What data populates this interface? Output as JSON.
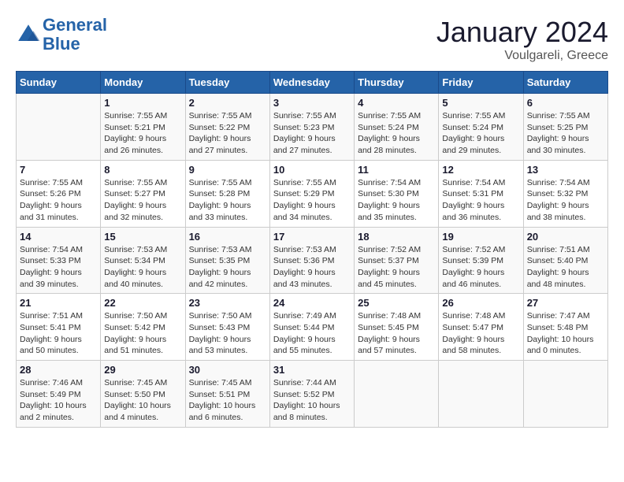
{
  "header": {
    "logo_line1": "General",
    "logo_line2": "Blue",
    "month_year": "January 2024",
    "location": "Voulgareli, Greece"
  },
  "weekdays": [
    "Sunday",
    "Monday",
    "Tuesday",
    "Wednesday",
    "Thursday",
    "Friday",
    "Saturday"
  ],
  "weeks": [
    [
      {
        "empty": true
      },
      {
        "day": 1,
        "sunrise": "7:55 AM",
        "sunset": "5:21 PM",
        "daylight": "9 hours and 26 minutes."
      },
      {
        "day": 2,
        "sunrise": "7:55 AM",
        "sunset": "5:22 PM",
        "daylight": "9 hours and 27 minutes."
      },
      {
        "day": 3,
        "sunrise": "7:55 AM",
        "sunset": "5:23 PM",
        "daylight": "9 hours and 27 minutes."
      },
      {
        "day": 4,
        "sunrise": "7:55 AM",
        "sunset": "5:24 PM",
        "daylight": "9 hours and 28 minutes."
      },
      {
        "day": 5,
        "sunrise": "7:55 AM",
        "sunset": "5:24 PM",
        "daylight": "9 hours and 29 minutes."
      },
      {
        "day": 6,
        "sunrise": "7:55 AM",
        "sunset": "5:25 PM",
        "daylight": "9 hours and 30 minutes."
      }
    ],
    [
      {
        "day": 7,
        "sunrise": "7:55 AM",
        "sunset": "5:26 PM",
        "daylight": "9 hours and 31 minutes."
      },
      {
        "day": 8,
        "sunrise": "7:55 AM",
        "sunset": "5:27 PM",
        "daylight": "9 hours and 32 minutes."
      },
      {
        "day": 9,
        "sunrise": "7:55 AM",
        "sunset": "5:28 PM",
        "daylight": "9 hours and 33 minutes."
      },
      {
        "day": 10,
        "sunrise": "7:55 AM",
        "sunset": "5:29 PM",
        "daylight": "9 hours and 34 minutes."
      },
      {
        "day": 11,
        "sunrise": "7:54 AM",
        "sunset": "5:30 PM",
        "daylight": "9 hours and 35 minutes."
      },
      {
        "day": 12,
        "sunrise": "7:54 AM",
        "sunset": "5:31 PM",
        "daylight": "9 hours and 36 minutes."
      },
      {
        "day": 13,
        "sunrise": "7:54 AM",
        "sunset": "5:32 PM",
        "daylight": "9 hours and 38 minutes."
      }
    ],
    [
      {
        "day": 14,
        "sunrise": "7:54 AM",
        "sunset": "5:33 PM",
        "daylight": "9 hours and 39 minutes."
      },
      {
        "day": 15,
        "sunrise": "7:53 AM",
        "sunset": "5:34 PM",
        "daylight": "9 hours and 40 minutes."
      },
      {
        "day": 16,
        "sunrise": "7:53 AM",
        "sunset": "5:35 PM",
        "daylight": "9 hours and 42 minutes."
      },
      {
        "day": 17,
        "sunrise": "7:53 AM",
        "sunset": "5:36 PM",
        "daylight": "9 hours and 43 minutes."
      },
      {
        "day": 18,
        "sunrise": "7:52 AM",
        "sunset": "5:37 PM",
        "daylight": "9 hours and 45 minutes."
      },
      {
        "day": 19,
        "sunrise": "7:52 AM",
        "sunset": "5:39 PM",
        "daylight": "9 hours and 46 minutes."
      },
      {
        "day": 20,
        "sunrise": "7:51 AM",
        "sunset": "5:40 PM",
        "daylight": "9 hours and 48 minutes."
      }
    ],
    [
      {
        "day": 21,
        "sunrise": "7:51 AM",
        "sunset": "5:41 PM",
        "daylight": "9 hours and 50 minutes."
      },
      {
        "day": 22,
        "sunrise": "7:50 AM",
        "sunset": "5:42 PM",
        "daylight": "9 hours and 51 minutes."
      },
      {
        "day": 23,
        "sunrise": "7:50 AM",
        "sunset": "5:43 PM",
        "daylight": "9 hours and 53 minutes."
      },
      {
        "day": 24,
        "sunrise": "7:49 AM",
        "sunset": "5:44 PM",
        "daylight": "9 hours and 55 minutes."
      },
      {
        "day": 25,
        "sunrise": "7:48 AM",
        "sunset": "5:45 PM",
        "daylight": "9 hours and 57 minutes."
      },
      {
        "day": 26,
        "sunrise": "7:48 AM",
        "sunset": "5:47 PM",
        "daylight": "9 hours and 58 minutes."
      },
      {
        "day": 27,
        "sunrise": "7:47 AM",
        "sunset": "5:48 PM",
        "daylight": "10 hours and 0 minutes."
      }
    ],
    [
      {
        "day": 28,
        "sunrise": "7:46 AM",
        "sunset": "5:49 PM",
        "daylight": "10 hours and 2 minutes."
      },
      {
        "day": 29,
        "sunrise": "7:45 AM",
        "sunset": "5:50 PM",
        "daylight": "10 hours and 4 minutes."
      },
      {
        "day": 30,
        "sunrise": "7:45 AM",
        "sunset": "5:51 PM",
        "daylight": "10 hours and 6 minutes."
      },
      {
        "day": 31,
        "sunrise": "7:44 AM",
        "sunset": "5:52 PM",
        "daylight": "10 hours and 8 minutes."
      },
      {
        "empty": true
      },
      {
        "empty": true
      },
      {
        "empty": true
      }
    ]
  ]
}
